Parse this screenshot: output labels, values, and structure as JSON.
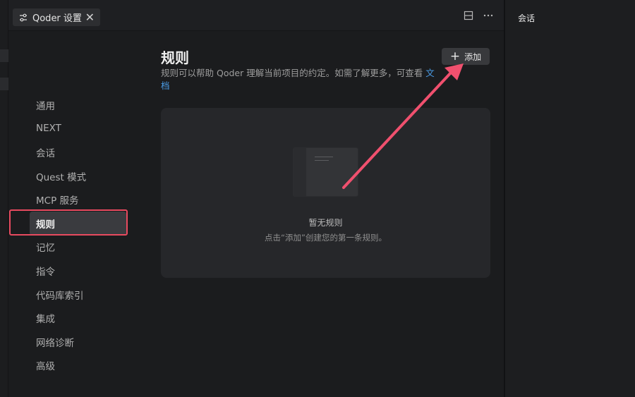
{
  "tab": {
    "title": "Qoder 设置",
    "close": "✕"
  },
  "right_panel": {
    "title": "会话"
  },
  "sidebar": {
    "items": [
      {
        "label": "通用"
      },
      {
        "label": "NEXT"
      },
      {
        "label": "会话"
      },
      {
        "label": "Quest 模式"
      },
      {
        "label": "MCP 服务"
      },
      {
        "label": "规则",
        "active": true
      },
      {
        "label": "记忆"
      },
      {
        "label": "指令"
      },
      {
        "label": "代码库索引"
      },
      {
        "label": "集成"
      },
      {
        "label": "网络诊断"
      },
      {
        "label": "高级"
      }
    ]
  },
  "main": {
    "title": "规则",
    "description": "规则可以帮助 Qoder 理解当前项目的约定。如需了解更多，可查看",
    "description_link": "文档",
    "add_button": "添加",
    "add_icon": "+",
    "empty": {
      "title": "暂无规则",
      "subtitle": "点击“添加”创建您的第一条规则。"
    }
  },
  "colors": {
    "accent_link": "#4a9de8",
    "highlight_box": "#e84a5f",
    "arrow": "#f0506e"
  },
  "icons": [
    "settings-icon",
    "close-icon",
    "split-layout-icon",
    "more-icon",
    "plus-icon",
    "document-icon",
    "annotation-arrow"
  ]
}
